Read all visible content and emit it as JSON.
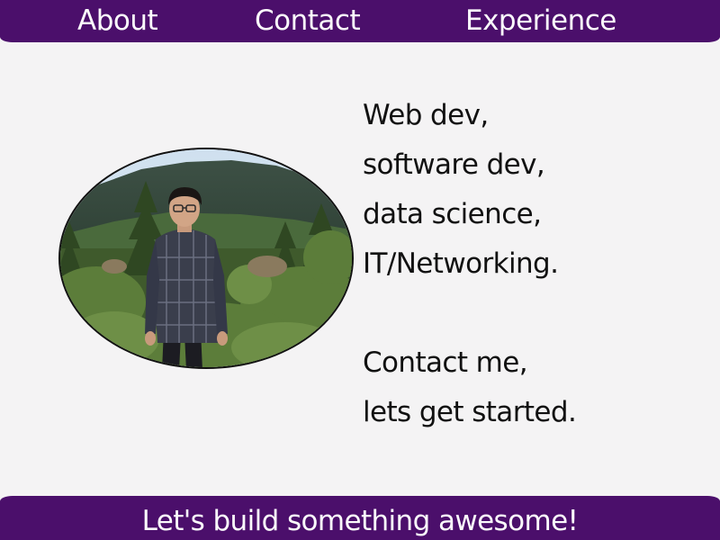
{
  "nav": {
    "links": [
      {
        "label": "About"
      },
      {
        "label": "Contact"
      },
      {
        "label": "Experience"
      }
    ]
  },
  "hero": {
    "tagline_lines": [
      "Web dev,",
      "software dev,",
      "data science,",
      "IT/Networking."
    ],
    "cta_lines": [
      "Contact me,",
      "lets get started."
    ]
  },
  "footer": {
    "text": "Let's build something awesome!"
  },
  "colors": {
    "brand": "#4b0f6b",
    "background": "#f4f3f4",
    "text_dark": "#111111",
    "text_light": "#fbfafc"
  }
}
